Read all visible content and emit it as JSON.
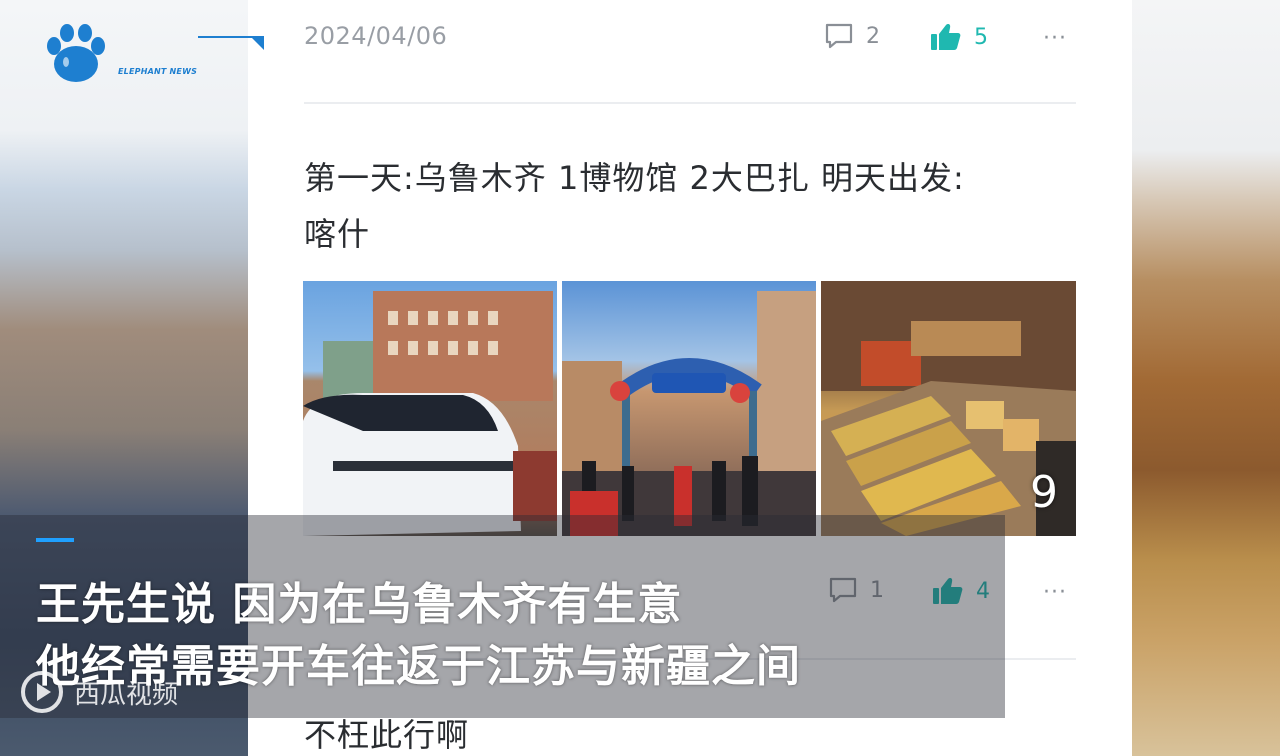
{
  "brand": {
    "name": "ELEPHANT NEWS",
    "color": "#1e7fd0",
    "icon": "paw-icon"
  },
  "post": {
    "date": "2024/04/06",
    "comments": "2",
    "likes": "5",
    "more": "···",
    "text_line1": "第一天:乌鲁木齐 1博物馆 2大巴扎 明天出发:",
    "text_line2": "喀什",
    "photo_extra_count": "9"
  },
  "next_post": {
    "comments": "1",
    "likes": "4",
    "more": "···",
    "text": "不枉此行啊"
  },
  "subtitle": {
    "line1": "王先生说 因为在乌鲁木齐有生意",
    "line2": "他经常需要开车往返于江苏与新疆之间"
  },
  "watermark": {
    "text": "西瓜视频"
  },
  "colors": {
    "accent": "#1fb8b0",
    "muted": "#8a8f96",
    "subtitle_dash": "#1fa0ff"
  }
}
